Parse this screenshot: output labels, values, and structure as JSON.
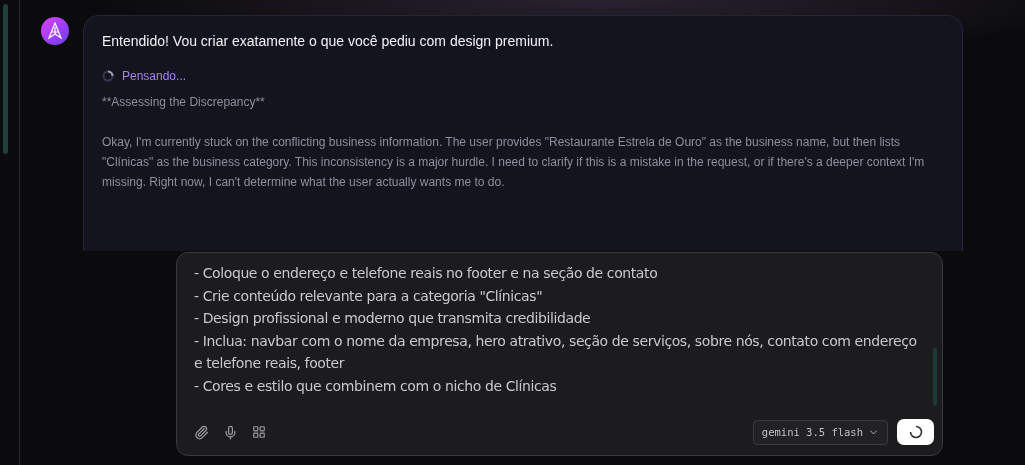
{
  "message": {
    "text": "Entendido! Vou criar exatamente o que você pediu com design premium.",
    "thinking": {
      "label": "Pensando...",
      "active": true
    },
    "paragraphs": [
      "**Assessing the Discrepancy**",
      "Okay, I'm currently stuck on the conflicting business information. The user provides \"Restaurante Estrela de Ouro\" as the business name, but then lists \"Clínicas\" as the business category. This inconsistency is a major hurdle. I need to clarify if this is a mistake in the request, or if there's a deeper context I'm missing. Right now, I can't determine what the user actually wants me to do."
    ]
  },
  "composer": {
    "lines": [
      "- Coloque o endereço e telefone reais no footer e na seção de contato",
      "- Crie conteúdo relevante para a categoria \"Clínicas\"",
      "- Design profissional e moderno que transmita credibilidade",
      "- Inclua: navbar com o nome da empresa, hero atrativo, seção de serviços, sobre nós, contato com endereço e telefone reais, footer",
      "- Cores e estilo que combinem com o nicho de Clínicas"
    ],
    "model": "gemini 3.5 flash",
    "sending": true
  }
}
